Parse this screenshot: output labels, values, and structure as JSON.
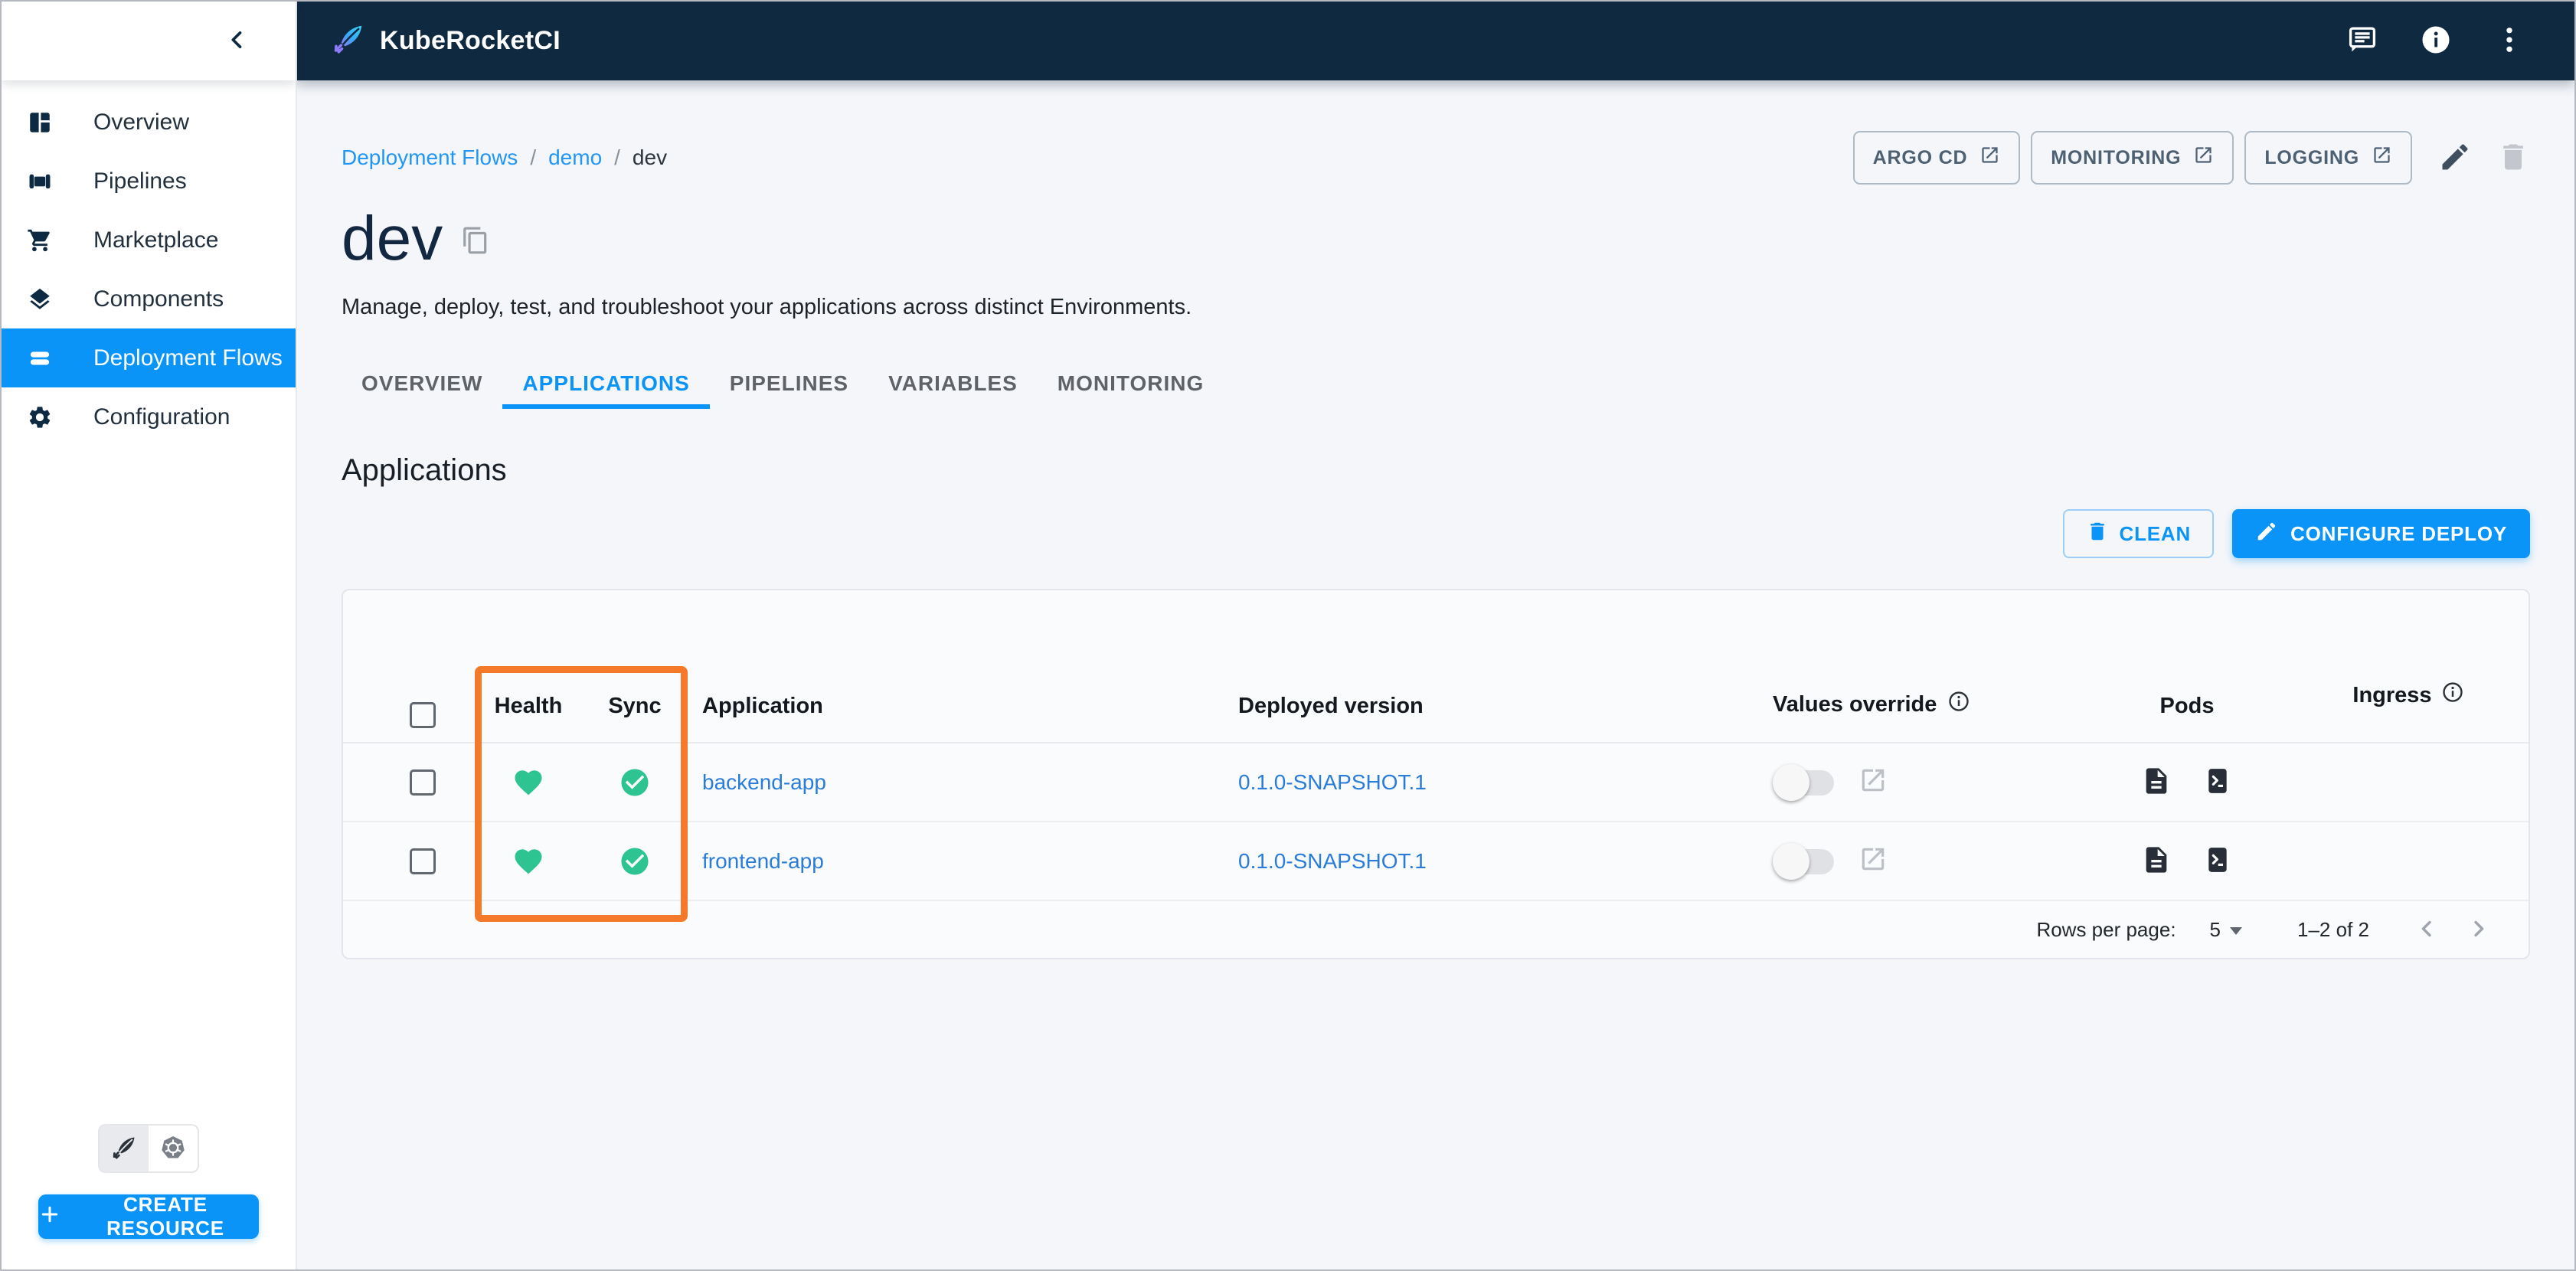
{
  "topbar": {
    "brand": "KubeRocketCI"
  },
  "sidebar": {
    "items": [
      {
        "label": "Overview"
      },
      {
        "label": "Pipelines"
      },
      {
        "label": "Marketplace"
      },
      {
        "label": "Components"
      },
      {
        "label": "Deployment Flows"
      },
      {
        "label": "Configuration"
      }
    ],
    "create_button_label": "CREATE RESOURCE"
  },
  "page": {
    "breadcrumb": {
      "items": [
        {
          "label": "Deployment Flows"
        },
        {
          "label": "demo"
        },
        {
          "label": "dev"
        }
      ],
      "separator": "/"
    },
    "title": "dev",
    "subtitle": "Manage, deploy, test, and troubleshoot your applications across distinct Environments.",
    "quick_links": [
      {
        "label": "ARGO CD"
      },
      {
        "label": "MONITORING"
      },
      {
        "label": "LOGGING"
      }
    ],
    "tabs": [
      {
        "label": "OVERVIEW"
      },
      {
        "label": "APPLICATIONS"
      },
      {
        "label": "PIPELINES"
      },
      {
        "label": "VARIABLES"
      },
      {
        "label": "MONITORING"
      }
    ],
    "section_title": "Applications",
    "clean_button_label": "CLEAN",
    "configure_deploy_button_label": "CONFIGURE DEPLOY"
  },
  "applications_table": {
    "headers": {
      "health": "Health",
      "sync": "Sync",
      "application": "Application",
      "deployed_version": "Deployed version",
      "values_override": "Values override",
      "pods": "Pods",
      "ingress": "Ingress"
    },
    "rows": [
      {
        "application": "backend-app",
        "deployed_version": "0.1.0-SNAPSHOT.1",
        "health": "healthy",
        "sync": "synced",
        "values_override": "off"
      },
      {
        "application": "frontend-app",
        "deployed_version": "0.1.0-SNAPSHOT.1",
        "health": "healthy",
        "sync": "synced",
        "values_override": "off"
      }
    ],
    "pagination": {
      "rows_per_page_label": "Rows per page:",
      "rows_per_page_value": "5",
      "range_label": "1–2 of 2"
    }
  },
  "colors": {
    "accent_blue": "#0a94f7",
    "link_blue": "#2a7cd9",
    "topbar_navy": "#0f2a40",
    "healthy_green": "#2dc492",
    "highlight_orange": "#f5792b"
  }
}
